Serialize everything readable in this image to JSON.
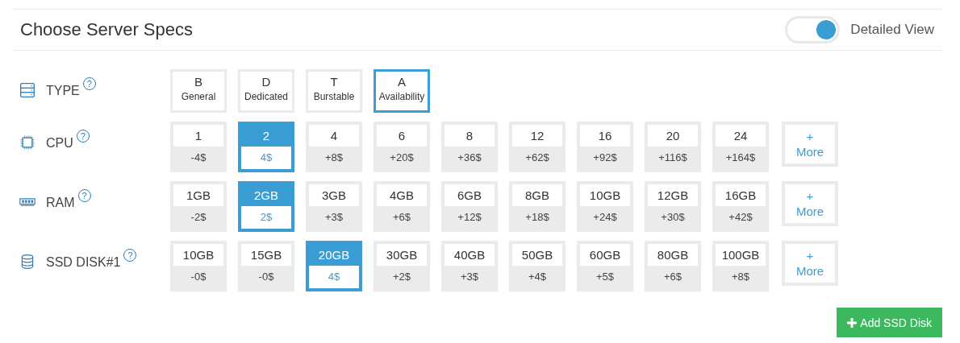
{
  "header": {
    "title": "Choose Server Specs",
    "toggle": {
      "on": true,
      "label": "Detailed View"
    }
  },
  "rows": [
    {
      "kind": "type",
      "label": "TYPE",
      "help": "?",
      "options": [
        {
          "code": "B",
          "name": "General",
          "selected": false
        },
        {
          "code": "D",
          "name": "Dedicated",
          "selected": false
        },
        {
          "code": "T",
          "name": "Burstable",
          "selected": false
        },
        {
          "code": "A",
          "name": "Availability",
          "selected": true
        }
      ]
    },
    {
      "kind": "spec",
      "label": "CPU",
      "help": "?",
      "more": "+\nMore",
      "options": [
        {
          "value": "1",
          "price": "-4$",
          "selected": false
        },
        {
          "value": "2",
          "price": "4$",
          "selected": true
        },
        {
          "value": "4",
          "price": "+8$",
          "selected": false
        },
        {
          "value": "6",
          "price": "+20$",
          "selected": false
        },
        {
          "value": "8",
          "price": "+36$",
          "selected": false
        },
        {
          "value": "12",
          "price": "+62$",
          "selected": false
        },
        {
          "value": "16",
          "price": "+92$",
          "selected": false
        },
        {
          "value": "20",
          "price": "+116$",
          "selected": false
        },
        {
          "value": "24",
          "price": "+164$",
          "selected": false
        }
      ]
    },
    {
      "kind": "spec",
      "label": "RAM",
      "help": "?",
      "more": "+\nMore",
      "options": [
        {
          "value": "1GB",
          "price": "-2$",
          "selected": false
        },
        {
          "value": "2GB",
          "price": "2$",
          "selected": true
        },
        {
          "value": "3GB",
          "price": "+3$",
          "selected": false
        },
        {
          "value": "4GB",
          "price": "+6$",
          "selected": false
        },
        {
          "value": "6GB",
          "price": "+12$",
          "selected": false
        },
        {
          "value": "8GB",
          "price": "+18$",
          "selected": false
        },
        {
          "value": "10GB",
          "price": "+24$",
          "selected": false
        },
        {
          "value": "12GB",
          "price": "+30$",
          "selected": false
        },
        {
          "value": "16GB",
          "price": "+42$",
          "selected": false
        }
      ]
    },
    {
      "kind": "spec",
      "label": "SSD DISK#1",
      "help": "?",
      "more": "+\nMore",
      "options": [
        {
          "value": "10GB",
          "price": "-0$",
          "selected": false
        },
        {
          "value": "15GB",
          "price": "-0$",
          "selected": false
        },
        {
          "value": "20GB",
          "price": "4$",
          "selected": true
        },
        {
          "value": "30GB",
          "price": "+2$",
          "selected": false
        },
        {
          "value": "40GB",
          "price": "+3$",
          "selected": false
        },
        {
          "value": "50GB",
          "price": "+4$",
          "selected": false
        },
        {
          "value": "60GB",
          "price": "+5$",
          "selected": false
        },
        {
          "value": "80GB",
          "price": "+6$",
          "selected": false
        },
        {
          "value": "100GB",
          "price": "+8$",
          "selected": false
        }
      ]
    }
  ],
  "add_button": "Add SSD Disk"
}
